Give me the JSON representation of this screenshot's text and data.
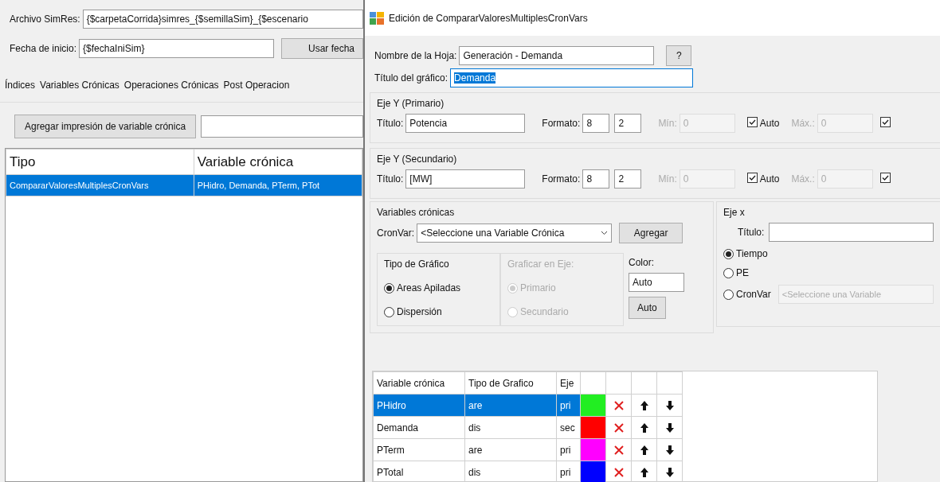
{
  "background_window": {
    "archivo": {
      "label": "Archivo SimRes:",
      "value": "{$carpetaCorrida}simres_{$semillaSim}_{$escenario"
    },
    "fecha": {
      "label": "Fecha de inicio:",
      "value": "{$fechaIniSim}",
      "button": "Usar fecha"
    },
    "tabs": [
      "Índices",
      "Variables Crónicas",
      "Operaciones Crónicas",
      "Post Operacion"
    ],
    "add_button": "Agregar impresión de variable crónica",
    "table": {
      "columns": [
        "Tipo",
        "Variable crónica"
      ],
      "rows": [
        {
          "cells": [
            "CompararValoresMultiplesCronVars",
            "PHidro, Demanda, PTerm, PTot"
          ],
          "selected": true
        }
      ]
    }
  },
  "dialog": {
    "title": "Edición de CompararValoresMultiplesCronVars",
    "sheet_name": {
      "label": "Nombre de la Hoja:",
      "value": "Generación - Demanda",
      "help_button": "?"
    },
    "chart_title": {
      "label": "Título del gráfico:",
      "value": "Demanda",
      "text_selected": true
    },
    "y_axes": [
      {
        "title": "Eje Y (Primario)",
        "titulo_label": "Título:",
        "titulo_value": "Potencia",
        "formato_label": "Formato:",
        "formato_values": [
          "8",
          "2"
        ],
        "min_label": "Mín:",
        "min_value": "0",
        "auto_label": "Auto",
        "auto_checked": true,
        "max_label": "Máx.:",
        "max_value": "0",
        "max_auto_checked": true
      },
      {
        "title": "Eje Y (Secundario)",
        "titulo_label": "Título:",
        "titulo_value": "[MW]",
        "formato_label": "Formato:",
        "formato_values": [
          "8",
          "2"
        ],
        "min_label": "Mín:",
        "min_value": "0",
        "auto_label": "Auto",
        "auto_checked": true,
        "max_label": "Máx.:",
        "max_value": "0",
        "max_auto_checked": true
      }
    ],
    "variables": {
      "title": "Variables crónicas",
      "cronvar_label": "CronVar:",
      "cronvar_value": "<Seleccione una Variable Crónica",
      "add_button": "Agregar",
      "chart_type": {
        "title": "Tipo de Gráfico",
        "disabled": false,
        "options": [
          {
            "label": "Areas Apiladas",
            "selected": true
          },
          {
            "label": "Dispersión",
            "selected": false
          }
        ]
      },
      "plot_axis": {
        "title": "Graficar en Eje:",
        "disabled": true,
        "options": [
          {
            "label": "Primario",
            "selected": true
          },
          {
            "label": "Secundario",
            "selected": false
          }
        ]
      },
      "color": {
        "title": "Color:",
        "value": "Auto",
        "button": "Auto"
      }
    },
    "x_axis": {
      "title": "Eje x",
      "titulo_label": "Título:",
      "options": [
        {
          "label": "Tiempo",
          "selected": true
        },
        {
          "label": "PE",
          "selected": false
        },
        {
          "label": "CronVar",
          "selected": false
        }
      ],
      "cronvar_value": "<Seleccione una Variable"
    },
    "table": {
      "columns": [
        "Variable crónica",
        "Tipo de Grafico",
        "Eje"
      ],
      "rows": [
        {
          "name": "PHidro",
          "tipo": "are",
          "eje": "pri",
          "color": "#22ee22",
          "selected": true
        },
        {
          "name": "Demanda",
          "tipo": "dis",
          "eje": "sec",
          "color": "#ff0000",
          "selected": false
        },
        {
          "name": "PTerm",
          "tipo": "are",
          "eje": "pri",
          "color": "#ff00ff",
          "selected": false
        },
        {
          "name": "PTotal",
          "tipo": "dis",
          "eje": "pri",
          "color": "#0000ff",
          "selected": false
        }
      ]
    }
  }
}
